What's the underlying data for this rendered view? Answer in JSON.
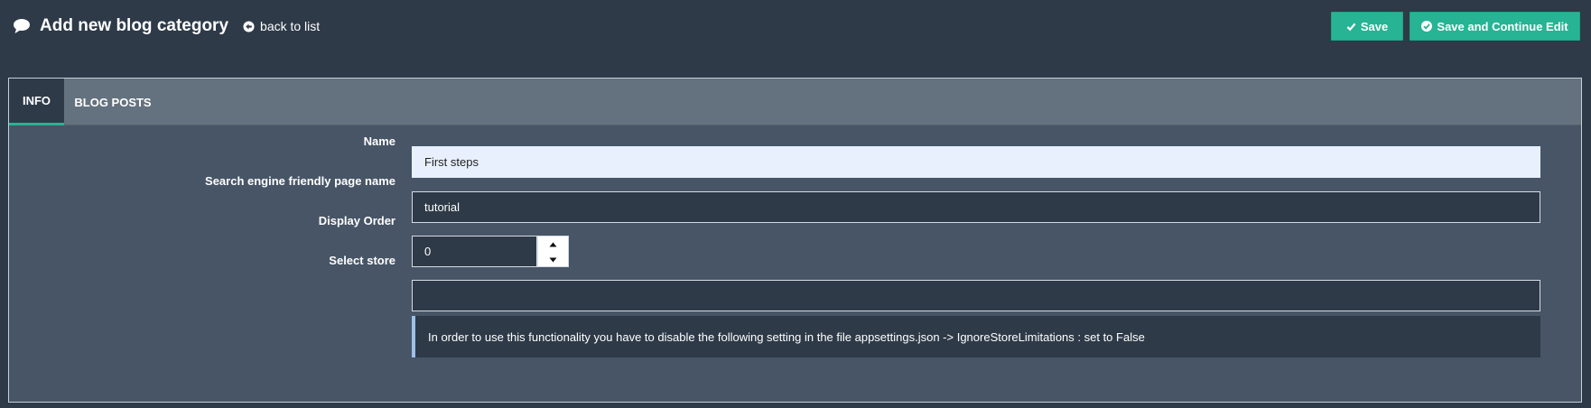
{
  "header": {
    "title": "Add new blog category",
    "back_link": "back to list",
    "title_icon": "comment-icon",
    "back_icon": "arrow-circle-left-icon"
  },
  "toolbar": {
    "save_label": "Save",
    "save_continue_label": "Save and Continue Edit",
    "accent_color": "#26b494"
  },
  "tabs": [
    {
      "label": "INFO",
      "active": true
    },
    {
      "label": "BLOG POSTS",
      "active": false
    }
  ],
  "form": {
    "name": {
      "label": "Name",
      "value": "First steps"
    },
    "sename": {
      "label": "Search engine friendly page name",
      "value": "tutorial"
    },
    "display_order": {
      "label": "Display Order",
      "value": "0"
    },
    "store": {
      "label": "Select store",
      "value": ""
    },
    "store_note": "In order to use this functionality you have to disable the following setting in the file appsettings.json -> IgnoreStoreLimitations : set to False"
  }
}
